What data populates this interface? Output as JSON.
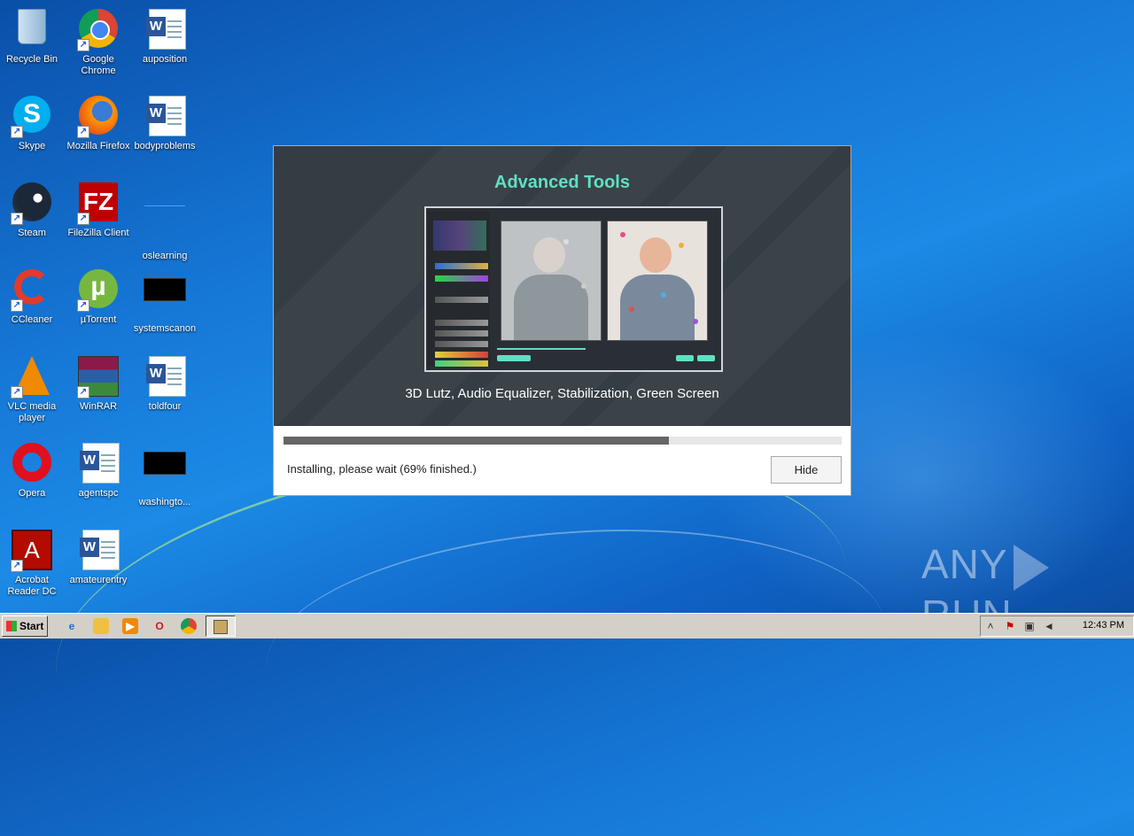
{
  "desktop": {
    "icons": [
      {
        "label": "Recycle Bin",
        "icon": "recycle-bin-icon"
      },
      {
        "label": "Google Chrome",
        "icon": "chrome-icon"
      },
      {
        "label": "auposition",
        "icon": "word-doc-icon"
      },
      {
        "label": "Skype",
        "icon": "skype-icon"
      },
      {
        "label": "Mozilla Firefox",
        "icon": "firefox-icon"
      },
      {
        "label": "bodyproblems",
        "icon": "word-doc-icon"
      },
      {
        "label": "Steam",
        "icon": "steam-icon"
      },
      {
        "label": "FileZilla Client",
        "icon": "filezilla-icon"
      },
      {
        "label": "oslearning",
        "icon": "blank-file-icon"
      },
      {
        "label": "CCleaner",
        "icon": "ccleaner-icon"
      },
      {
        "label": "µTorrent",
        "icon": "utorrent-icon"
      },
      {
        "label": "systemscanon",
        "icon": "black-file-icon"
      },
      {
        "label": "VLC media player",
        "icon": "vlc-icon"
      },
      {
        "label": "WinRAR",
        "icon": "winrar-icon"
      },
      {
        "label": "toldfour",
        "icon": "word-doc-icon"
      },
      {
        "label": "Opera",
        "icon": "opera-icon"
      },
      {
        "label": "agentspc",
        "icon": "word-doc-icon"
      },
      {
        "label": "washingto...",
        "icon": "black-file-icon"
      },
      {
        "label": "Acrobat Reader DC",
        "icon": "acrobat-icon"
      },
      {
        "label": "amateurentry",
        "icon": "word-doc-icon"
      }
    ]
  },
  "installer": {
    "banner_title": "Advanced Tools",
    "banner_subtitle": "3D Lutz, Audio Equalizer, Stabilization, Green Screen",
    "progress_fraction": 0.69,
    "status_text": "Installing, please wait (69% finished.)",
    "hide_label": "Hide"
  },
  "watermark": {
    "left": "ANY",
    "right": "RUN"
  },
  "taskbar": {
    "start_label": "Start",
    "quick_launch": [
      "ie-icon",
      "explorer-icon",
      "media-player-icon",
      "opera-icon",
      "chrome-icon"
    ],
    "active_task_icon": "installer-icon",
    "tray_icons": [
      "show-hidden-icon",
      "action-center-icon",
      "network-icon",
      "volume-icon"
    ],
    "clock": "12:43 PM"
  },
  "colors": {
    "accent": "#5ee0c4",
    "banner_bg": "#353d44",
    "progress_fill": "#666666"
  }
}
